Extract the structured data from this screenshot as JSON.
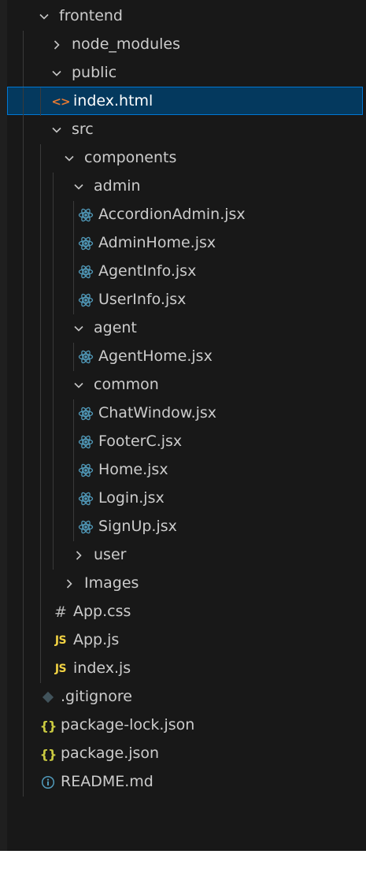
{
  "explorer": {
    "tree": [
      {
        "label": "frontend",
        "type": "folder",
        "expanded": true,
        "depth": 0
      },
      {
        "label": "node_modules",
        "type": "folder",
        "expanded": false,
        "depth": 1
      },
      {
        "label": "public",
        "type": "folder",
        "expanded": true,
        "depth": 1
      },
      {
        "label": "index.html",
        "type": "file",
        "icon": "html-file-icon",
        "depth": 2,
        "selected": true
      },
      {
        "label": "src",
        "type": "folder",
        "expanded": true,
        "depth": 1
      },
      {
        "label": "components",
        "type": "folder",
        "expanded": true,
        "depth": 2
      },
      {
        "label": "admin",
        "type": "folder",
        "expanded": true,
        "depth": 3
      },
      {
        "label": "AccordionAdmin.jsx",
        "type": "file",
        "icon": "react-file-icon",
        "depth": 4
      },
      {
        "label": "AdminHome.jsx",
        "type": "file",
        "icon": "react-file-icon",
        "depth": 4
      },
      {
        "label": "AgentInfo.jsx",
        "type": "file",
        "icon": "react-file-icon",
        "depth": 4
      },
      {
        "label": "UserInfo.jsx",
        "type": "file",
        "icon": "react-file-icon",
        "depth": 4
      },
      {
        "label": "agent",
        "type": "folder",
        "expanded": true,
        "depth": 3
      },
      {
        "label": "AgentHome.jsx",
        "type": "file",
        "icon": "react-file-icon",
        "depth": 4
      },
      {
        "label": "common",
        "type": "folder",
        "expanded": true,
        "depth": 3
      },
      {
        "label": "ChatWindow.jsx",
        "type": "file",
        "icon": "react-file-icon",
        "depth": 4
      },
      {
        "label": "FooterC.jsx",
        "type": "file",
        "icon": "react-file-icon",
        "depth": 4
      },
      {
        "label": "Home.jsx",
        "type": "file",
        "icon": "react-file-icon",
        "depth": 4
      },
      {
        "label": "Login.jsx",
        "type": "file",
        "icon": "react-file-icon",
        "depth": 4
      },
      {
        "label": "SignUp.jsx",
        "type": "file",
        "icon": "react-file-icon",
        "depth": 4
      },
      {
        "label": "user",
        "type": "folder",
        "expanded": false,
        "depth": 3
      },
      {
        "label": "Images",
        "type": "folder",
        "expanded": false,
        "depth": 2
      },
      {
        "label": "App.css",
        "type": "file",
        "icon": "css-file-icon",
        "depth": 2
      },
      {
        "label": "App.js",
        "type": "file",
        "icon": "js-file-icon",
        "depth": 2
      },
      {
        "label": "index.js",
        "type": "file",
        "icon": "js-file-icon",
        "depth": 2
      },
      {
        "label": ".gitignore",
        "type": "file",
        "icon": "git-file-icon",
        "depth": 1
      },
      {
        "label": "package-lock.json",
        "type": "file",
        "icon": "json-file-icon",
        "depth": 1
      },
      {
        "label": "package.json",
        "type": "file",
        "icon": "json-file-icon",
        "depth": 1
      },
      {
        "label": "README.md",
        "type": "file",
        "icon": "info-file-icon",
        "depth": 1
      }
    ],
    "glyphs": {
      "js-file-icon": "JS",
      "css-file-icon": "#",
      "json-file-icon": "{}",
      "html-file-icon": "<>"
    },
    "colors": {
      "background": "#181818",
      "selection": "#04395e",
      "selection_border": "#0078d4",
      "text": "#cccccc",
      "react_icon": "#519aba",
      "js_icon": "#f1d243",
      "json_icon": "#cbcb41",
      "html_icon": "#e37933",
      "info_icon": "#519aba"
    }
  }
}
